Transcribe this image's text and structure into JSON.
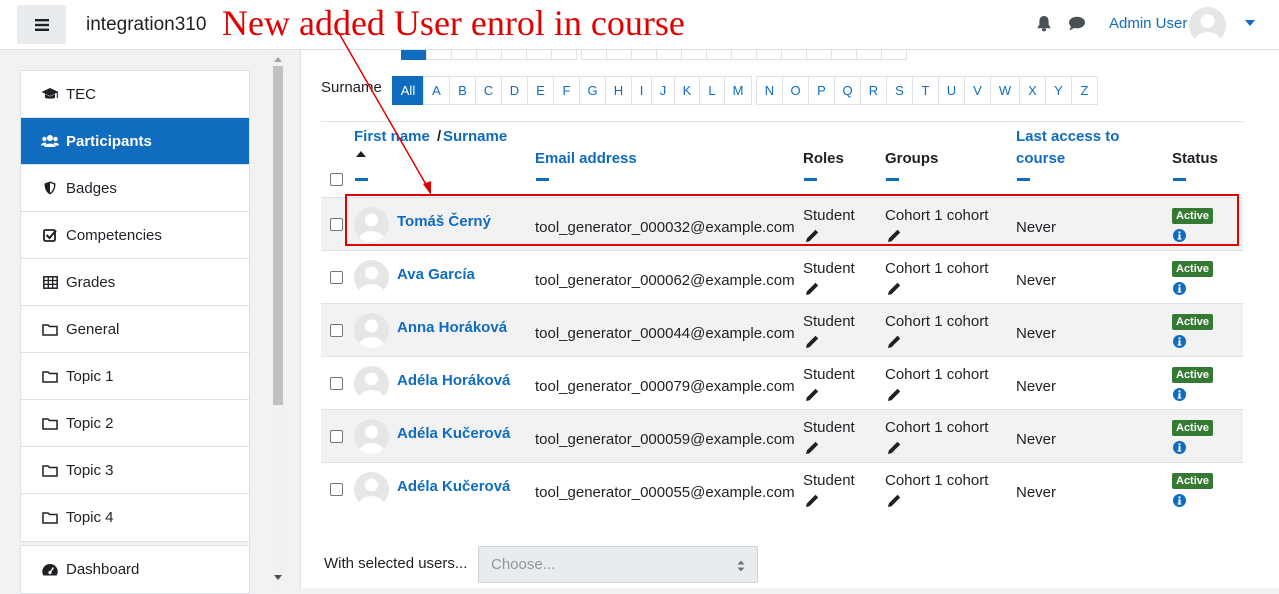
{
  "navbar": {
    "site_name": "integration310",
    "user_name": "Admin User"
  },
  "annotation": {
    "text": "New added User enrol in course",
    "color": "#e00000"
  },
  "nav": {
    "items": [
      {
        "label": "TEC",
        "icon": "graduation-cap-icon"
      },
      {
        "label": "Participants",
        "icon": "users-icon",
        "active": true
      },
      {
        "label": "Badges",
        "icon": "shield-icon"
      },
      {
        "label": "Competencies",
        "icon": "check-square-icon"
      },
      {
        "label": "Grades",
        "icon": "table-icon"
      },
      {
        "label": "General",
        "icon": "folder-icon"
      },
      {
        "label": "Topic 1",
        "icon": "folder-icon"
      },
      {
        "label": "Topic 2",
        "icon": "folder-icon"
      },
      {
        "label": "Topic 3",
        "icon": "folder-icon"
      },
      {
        "label": "Topic 4",
        "icon": "folder-icon"
      }
    ],
    "dashboard": {
      "label": "Dashboard",
      "icon": "tachometer-icon"
    }
  },
  "initials": {
    "label": "Surname",
    "all": "All",
    "letters": [
      "A",
      "B",
      "C",
      "D",
      "E",
      "F",
      "G",
      "H",
      "I",
      "J",
      "K",
      "L",
      "M",
      "N",
      "O",
      "P",
      "Q",
      "R",
      "S",
      "T",
      "U",
      "V",
      "W",
      "X",
      "Y",
      "Z"
    ]
  },
  "table": {
    "headers": {
      "first_name": "First name",
      "separator": "/",
      "surname": "Surname",
      "email": "Email address",
      "roles": "Roles",
      "groups": "Groups",
      "last_access_1": "Last access to",
      "last_access_2": "course",
      "status": "Status"
    },
    "rows": [
      {
        "name": "Tomáš Černý",
        "email": "tool_generator_000032@example.com",
        "role": "Student",
        "group": "Cohort 1 cohort",
        "access": "Never",
        "status": "Active"
      },
      {
        "name": "Ava García",
        "email": "tool_generator_000062@example.com",
        "role": "Student",
        "group": "Cohort 1 cohort",
        "access": "Never",
        "status": "Active"
      },
      {
        "name": "Anna Horáková",
        "email": "tool_generator_000044@example.com",
        "role": "Student",
        "group": "Cohort 1 cohort",
        "access": "Never",
        "status": "Active"
      },
      {
        "name": "Adéla Horáková",
        "email": "tool_generator_000079@example.com",
        "role": "Student",
        "group": "Cohort 1 cohort",
        "access": "Never",
        "status": "Active"
      },
      {
        "name": "Adéla Kučerová",
        "email": "tool_generator_000059@example.com",
        "role": "Student",
        "group": "Cohort 1 cohort",
        "access": "Never",
        "status": "Active"
      },
      {
        "name": "Adéla Kučerová",
        "email": "tool_generator_000055@example.com",
        "role": "Student",
        "group": "Cohort 1 cohort",
        "access": "Never",
        "status": "Active"
      }
    ]
  },
  "bulk": {
    "label": "With selected users...",
    "placeholder": "Choose..."
  },
  "colors": {
    "brand": "#0f6cbf",
    "active_badge": "#357a32"
  }
}
